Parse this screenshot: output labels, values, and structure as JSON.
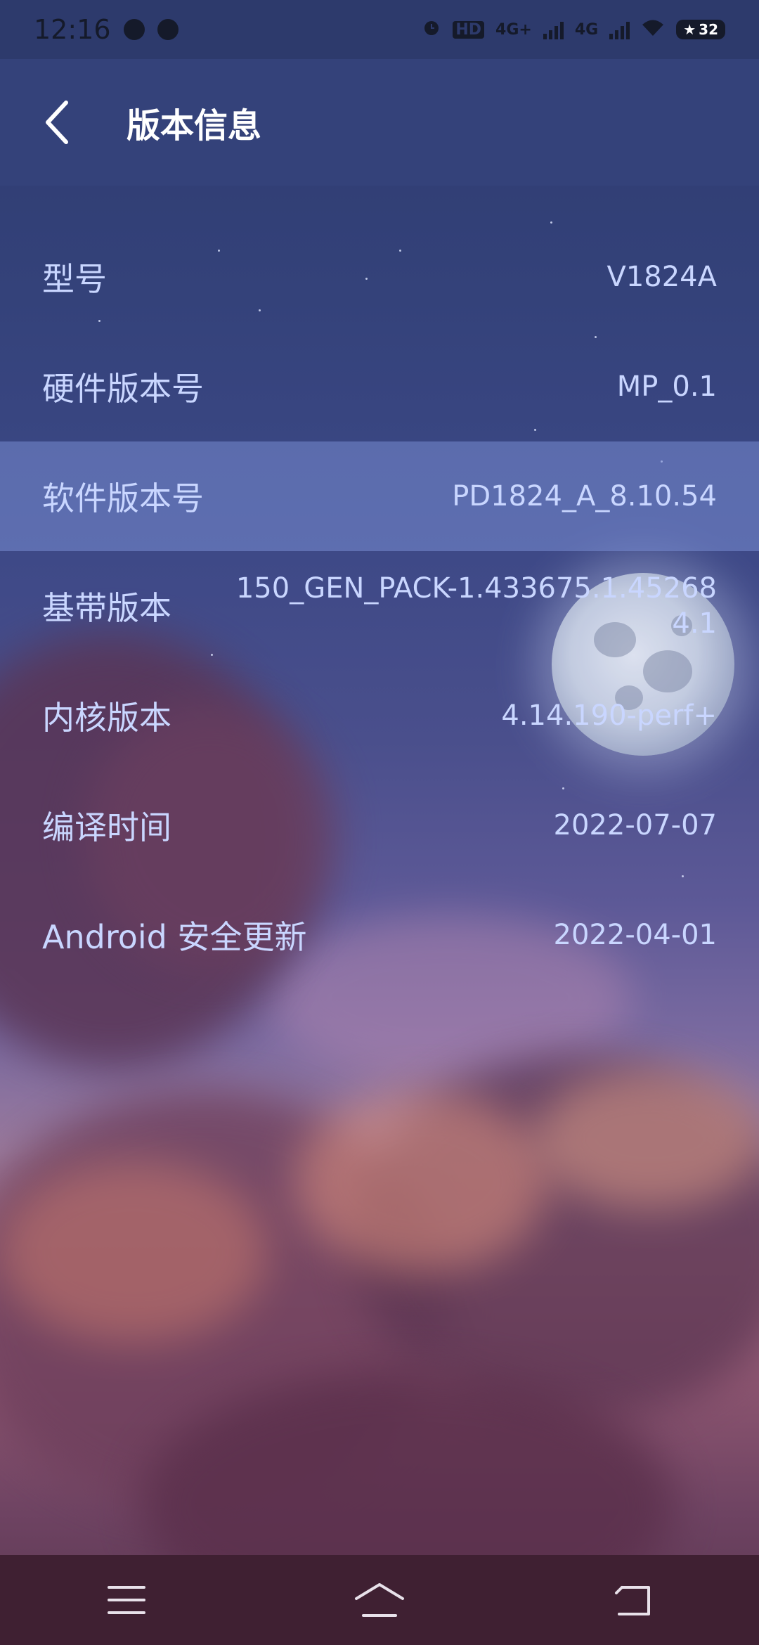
{
  "status_bar": {
    "time": "12:16",
    "network_1": "4G+",
    "network_2": "4G",
    "hd_label": "HD",
    "battery": "32"
  },
  "header": {
    "title": "版本信息"
  },
  "info": [
    {
      "label": "型号",
      "value": "V1824A"
    },
    {
      "label": "硬件版本号",
      "value": "MP_0.1"
    },
    {
      "label": "软件版本号",
      "value": "PD1824_A_8.10.54"
    },
    {
      "label": "基带版本",
      "value": "150_GEN_PACK-1.433675.1.452684.1"
    },
    {
      "label": "内核版本",
      "value": "4.14.190-perf+"
    },
    {
      "label": "编译时间",
      "value": "2022-07-07"
    },
    {
      "label": "Android 安全更新",
      "value": "2022-04-01"
    }
  ],
  "nav": {
    "menu_icon": "menu-icon",
    "home_icon": "home-icon",
    "back_icon": "back-icon"
  },
  "colors": {
    "header_bg": "#34427a",
    "highlight_row": "#6f83cc",
    "text": "#c9d6ff",
    "nav_bg": "#3f2032"
  }
}
